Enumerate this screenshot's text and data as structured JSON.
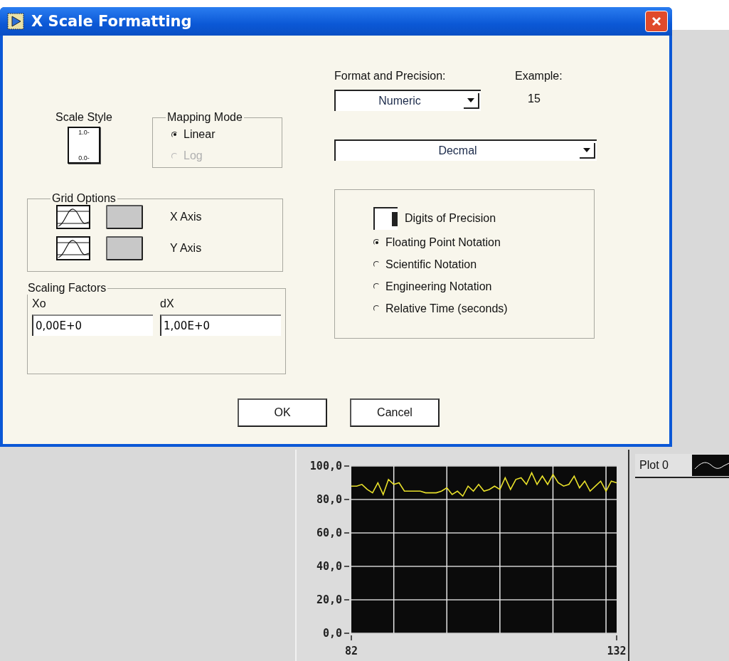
{
  "window": {
    "title": "X Scale Formatting"
  },
  "scale_style": {
    "label": "Scale Style",
    "top": "1.0-",
    "bottom": "0.0-"
  },
  "mapping_mode": {
    "label": "Mapping Mode",
    "options": [
      {
        "label": "Linear",
        "selected": true,
        "disabled": false
      },
      {
        "label": "Log",
        "selected": false,
        "disabled": true
      }
    ]
  },
  "grid_options": {
    "label": "Grid Options",
    "rows": [
      {
        "label": "X Axis"
      },
      {
        "label": "Y Axis"
      }
    ]
  },
  "scaling_factors": {
    "label": "Scaling Factors",
    "fields": [
      {
        "label": "Xo",
        "value": "0,00E+0"
      },
      {
        "label": "dX",
        "value": "1,00E+0"
      }
    ]
  },
  "format": {
    "label": "Format and Precision:",
    "value": "Numeric"
  },
  "example": {
    "label": "Example:",
    "value": "15"
  },
  "representation": {
    "value": "Decmal"
  },
  "precision": {
    "label": "Digits of Precision"
  },
  "notations": [
    {
      "label": "Floating Point Notation",
      "selected": true
    },
    {
      "label": "Scientific Notation",
      "selected": false
    },
    {
      "label": "Engineering Notation",
      "selected": false
    },
    {
      "label": "Relative Time (seconds)",
      "selected": false
    }
  ],
  "buttons": [
    {
      "label": "OK"
    },
    {
      "label": "Cancel"
    }
  ],
  "graph": {
    "chart_data": {
      "type": "line",
      "grid": true,
      "xlim": [
        82,
        132
      ],
      "ylim": [
        0,
        100
      ],
      "xticks": [
        82,
        132
      ],
      "yticks": [
        {
          "value": 0,
          "label": "0,0"
        },
        {
          "value": 20,
          "label": "20,0"
        },
        {
          "value": 40,
          "label": "40,0"
        },
        {
          "value": 60,
          "label": "60,0"
        },
        {
          "value": 80,
          "label": "80,0"
        },
        {
          "value": 100,
          "label": "100,0"
        }
      ],
      "x": [
        82,
        83,
        84,
        85,
        86,
        87,
        88,
        89,
        90,
        91,
        92,
        93,
        94,
        95,
        96,
        97,
        98,
        99,
        100,
        101,
        102,
        103,
        104,
        105,
        106,
        107,
        108,
        109,
        110,
        111,
        112,
        113,
        114,
        115,
        116,
        117,
        118,
        119,
        120,
        121,
        122,
        123,
        124,
        125,
        126,
        127,
        128,
        129,
        130,
        131,
        132
      ],
      "series": [
        {
          "name": "Plot 0",
          "color": "#e8e02a",
          "values": [
            88,
            88,
            89,
            86,
            84,
            90,
            83,
            92,
            89,
            90,
            85,
            85,
            85,
            85,
            84,
            84,
            84,
            85,
            87,
            83,
            85,
            82,
            88,
            85,
            89,
            85,
            86,
            88,
            86,
            93,
            86,
            92,
            93,
            89,
            96,
            89,
            94,
            89,
            95,
            90,
            88,
            89,
            94,
            87,
            91,
            85,
            88,
            91,
            85,
            91,
            90
          ]
        }
      ]
    }
  }
}
